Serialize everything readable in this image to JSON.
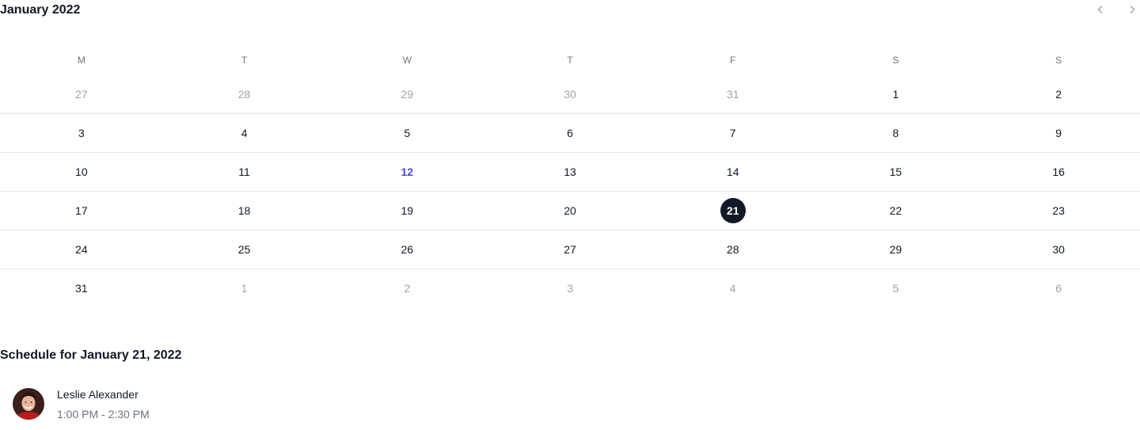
{
  "calendar": {
    "month_title": "January 2022",
    "prev_label": "‹",
    "next_label": "›",
    "weekdays": [
      "M",
      "T",
      "W",
      "T",
      "F",
      "S",
      "S"
    ],
    "weeks": [
      [
        {
          "day": "27",
          "state": "muted"
        },
        {
          "day": "28",
          "state": "muted"
        },
        {
          "day": "29",
          "state": "muted"
        },
        {
          "day": "30",
          "state": "muted"
        },
        {
          "day": "31",
          "state": "muted"
        },
        {
          "day": "1",
          "state": "normal"
        },
        {
          "day": "2",
          "state": "normal"
        }
      ],
      [
        {
          "day": "3",
          "state": "normal"
        },
        {
          "day": "4",
          "state": "normal"
        },
        {
          "day": "5",
          "state": "normal"
        },
        {
          "day": "6",
          "state": "normal"
        },
        {
          "day": "7",
          "state": "normal"
        },
        {
          "day": "8",
          "state": "normal"
        },
        {
          "day": "9",
          "state": "normal"
        }
      ],
      [
        {
          "day": "10",
          "state": "normal"
        },
        {
          "day": "11",
          "state": "normal"
        },
        {
          "day": "12",
          "state": "today"
        },
        {
          "day": "13",
          "state": "normal"
        },
        {
          "day": "14",
          "state": "normal"
        },
        {
          "day": "15",
          "state": "normal"
        },
        {
          "day": "16",
          "state": "normal"
        }
      ],
      [
        {
          "day": "17",
          "state": "normal"
        },
        {
          "day": "18",
          "state": "normal"
        },
        {
          "day": "19",
          "state": "normal"
        },
        {
          "day": "20",
          "state": "normal"
        },
        {
          "day": "21",
          "state": "selected"
        },
        {
          "day": "22",
          "state": "normal"
        },
        {
          "day": "23",
          "state": "normal"
        }
      ],
      [
        {
          "day": "24",
          "state": "normal"
        },
        {
          "day": "25",
          "state": "normal"
        },
        {
          "day": "26",
          "state": "normal"
        },
        {
          "day": "27",
          "state": "normal"
        },
        {
          "day": "28",
          "state": "normal"
        },
        {
          "day": "29",
          "state": "normal"
        },
        {
          "day": "30",
          "state": "normal"
        }
      ],
      [
        {
          "day": "31",
          "state": "normal"
        },
        {
          "day": "1",
          "state": "muted"
        },
        {
          "day": "2",
          "state": "muted"
        },
        {
          "day": "3",
          "state": "muted"
        },
        {
          "day": "4",
          "state": "muted"
        },
        {
          "day": "5",
          "state": "muted"
        },
        {
          "day": "6",
          "state": "muted"
        }
      ]
    ]
  },
  "schedule": {
    "title": "Schedule for January 21, 2022",
    "meetings": [
      {
        "name": "Leslie Alexander",
        "time": "1:00 PM - 2:30 PM",
        "avatar_icon": "person-avatar-icon"
      }
    ]
  },
  "colors": {
    "text": "#111827",
    "muted": "#9ca3af",
    "today": "#4f46e5",
    "selected_bg": "#111827",
    "divider": "#e5e7eb"
  }
}
